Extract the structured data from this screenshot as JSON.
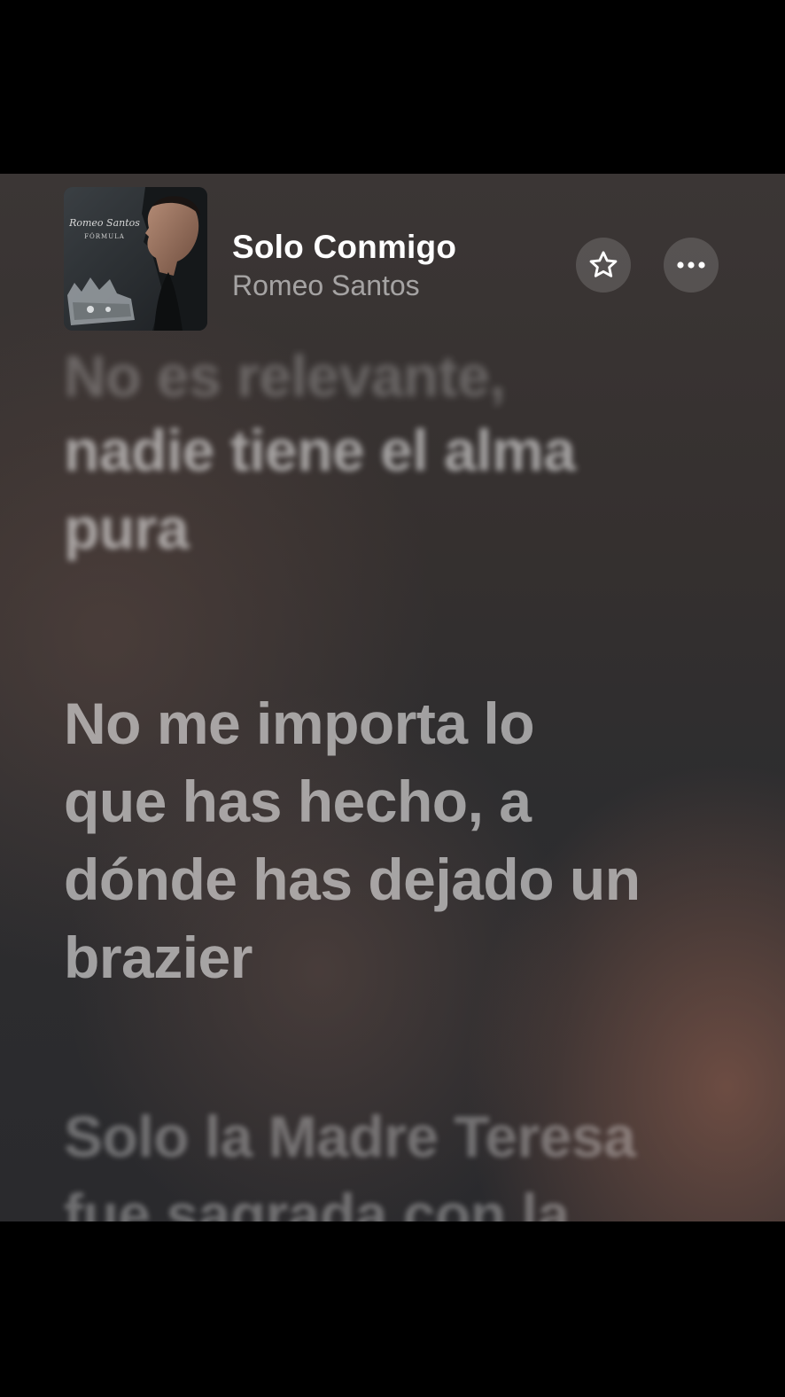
{
  "now_playing": {
    "title": "Solo Conmigo",
    "artist": "Romeo Santos",
    "album_art_text": [
      "Romeo Santos",
      "FÓRMULA"
    ]
  },
  "buttons": {
    "favorite_icon": "star-icon",
    "more_icon": "ellipsis-icon"
  },
  "lyrics": {
    "previous_partial": "No es relevante,",
    "previous_line_1": "nadie tiene el alma",
    "previous_line_2": "pura",
    "current": [
      "No me importa lo",
      "que has hecho, a",
      "dónde has dejado un",
      "brazier"
    ],
    "next": [
      "Solo la Madre Teresa",
      "fue sagrada con la"
    ]
  },
  "colors": {
    "background_top": "#3b3635",
    "background_bottom": "#2a2a2d",
    "accent_glow": "#785246",
    "title": "#ffffff"
  }
}
